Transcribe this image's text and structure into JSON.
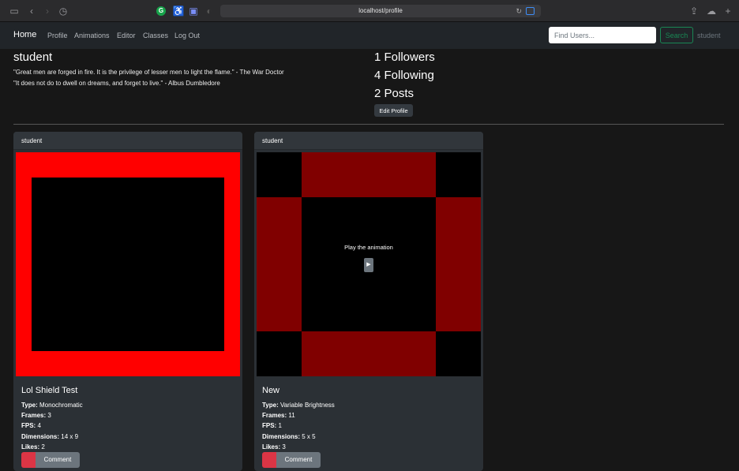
{
  "browser": {
    "url": "localhost/profile"
  },
  "nav": {
    "brand": "Home",
    "links": [
      "Profile",
      "Animations",
      "Editor",
      "Classes",
      "Log Out"
    ],
    "search_placeholder": "Find Users...",
    "search_label": "Search",
    "user": "student"
  },
  "profile": {
    "username": "student",
    "quotes": [
      "\"Great men are forged in fire. It is the privilege of lesser men to light the flame.\" - The War Doctor",
      "\"It does not do to dwell on dreams, and forget to live.\" - Albus Dumbledore"
    ],
    "followers": "1 Followers",
    "following": "4 Following",
    "posts": "2 Posts",
    "edit_label": "Edit Profile"
  },
  "cards": [
    {
      "author": "student",
      "title": "Lol Shield Test",
      "type_label": "Type:",
      "type": "Monochromatic",
      "frames_label": "Frames:",
      "frames": "3",
      "fps_label": "FPS:",
      "fps": "4",
      "dimensions_label": "Dimensions:",
      "dimensions": "14 x 9",
      "likes_label": "Likes:",
      "likes": "2",
      "comment_label": "Comment"
    },
    {
      "author": "student",
      "title": "New",
      "type_label": "Type:",
      "type": "Variable Brightness",
      "frames_label": "Frames:",
      "frames": "11",
      "fps_label": "FPS:",
      "fps": "1",
      "dimensions_label": "Dimensions:",
      "dimensions": "5 x 5",
      "likes_label": "Likes:",
      "likes": "3",
      "comment_label": "Comment",
      "play_text": "Play the animation",
      "play_icon": "▶"
    }
  ],
  "colors": {
    "bright_red": "#ff0000",
    "dark_red": "#800000",
    "black": "#000000",
    "success": "#198754",
    "danger": "#dc3545"
  }
}
